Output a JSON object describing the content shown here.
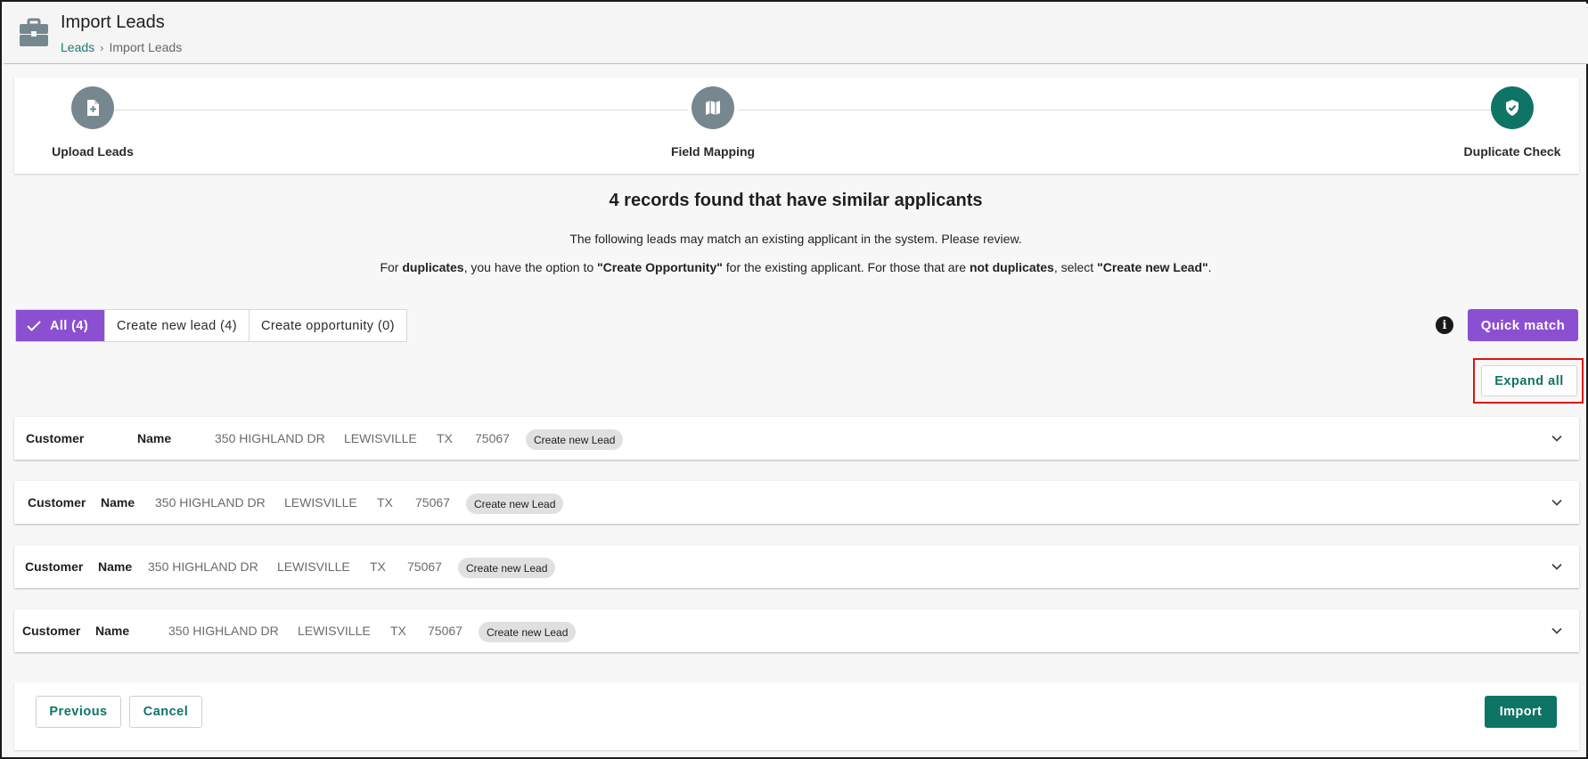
{
  "header": {
    "title": "Import Leads",
    "breadcrumb": {
      "parent": "Leads",
      "separator": "›",
      "current": "Import Leads"
    }
  },
  "stepper": {
    "steps": [
      {
        "label": "Upload Leads",
        "icon": "file-plus-icon",
        "state": "complete"
      },
      {
        "label": "Field Mapping",
        "icon": "map-icon",
        "state": "complete"
      },
      {
        "label": "Duplicate Check",
        "icon": "shield-check-icon",
        "state": "active"
      }
    ]
  },
  "info": {
    "headline": "4 records found that have similar applicants",
    "line1": "The following leads may match an existing applicant in the system. Please review.",
    "line2": {
      "p1": "For ",
      "b1": "duplicates",
      "p2": ", you have the option to ",
      "b2": "\"Create Opportunity\"",
      "p3": " for the existing applicant. For those that are ",
      "b3": "not duplicates",
      "p4": ", select ",
      "b4": "\"Create new Lead\"",
      "p5": "."
    }
  },
  "filters": {
    "all": "All (4)",
    "create_new_lead": "Create new lead (4)",
    "create_opportunity": "Create opportunity (0)"
  },
  "actions": {
    "info_icon": "i",
    "quick_match": "Quick match",
    "expand_all": "Expand all"
  },
  "records": [
    {
      "customer": "Customer",
      "name": "Name",
      "address": "350 HIGHLAND DR",
      "city": "LEWISVILLE",
      "state": "TX",
      "zip": "75067",
      "action": "Create new Lead"
    },
    {
      "customer": "Customer",
      "name": "Name",
      "address": "350 HIGHLAND DR",
      "city": "LEWISVILLE",
      "state": "TX",
      "zip": "75067",
      "action": "Create new Lead"
    },
    {
      "customer": "Customer",
      "name": "Name",
      "address": "350 HIGHLAND DR",
      "city": "LEWISVILLE",
      "state": "TX",
      "zip": "75067",
      "action": "Create new Lead"
    },
    {
      "customer": "Customer",
      "name": "Name",
      "address": "350 HIGHLAND DR",
      "city": "LEWISVILLE",
      "state": "TX",
      "zip": "75067",
      "action": "Create new Lead"
    }
  ],
  "footer": {
    "previous": "Previous",
    "cancel": "Cancel",
    "import": "Import"
  },
  "colors": {
    "purple": "#8b4fd1",
    "teal": "#0e7466",
    "step_gray": "#76878f",
    "highlight": "#e01010"
  }
}
